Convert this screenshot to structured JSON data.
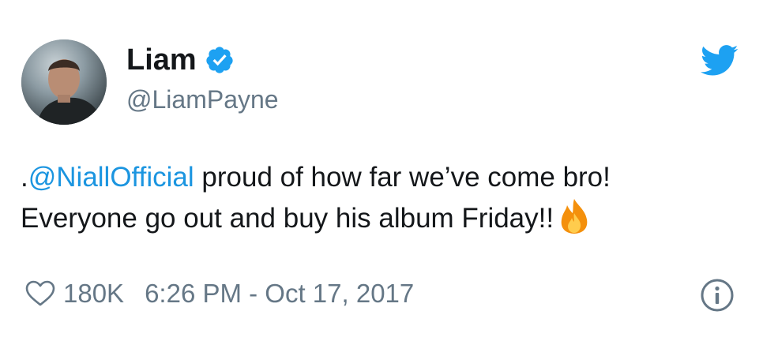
{
  "user": {
    "display_name": "Liam",
    "handle": "@LiamPayne",
    "verified": true
  },
  "tweet": {
    "text_prefix": ".",
    "mention": "@NiallOfficial",
    "line1_rest": " proud of how far we’ve come bro!",
    "line2": "Everyone go out and buy his album Friday!!",
    "emoji": "fire-icon"
  },
  "meta": {
    "likes": "180K",
    "timestamp": "6:26 PM - Oct 17, 2017"
  },
  "icons": {
    "brand": "twitter-bird-icon",
    "verified": "verified-badge-icon",
    "like": "heart-icon",
    "info": "info-icon"
  },
  "colors": {
    "brand_blue": "#1da1f2",
    "mention_blue": "#1b95e0",
    "secondary_text": "#657786",
    "primary_text": "#14171a"
  }
}
